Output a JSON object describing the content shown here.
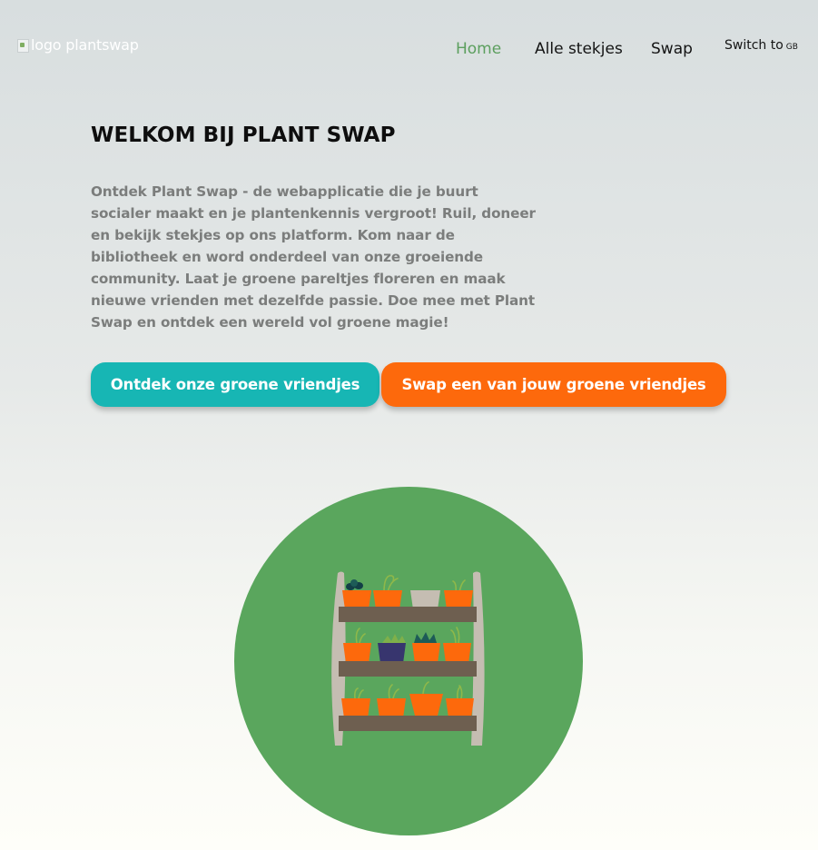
{
  "header": {
    "logo_alt": "logo plantswap",
    "nav": {
      "home": "Home",
      "all_cuttings": "Alle stekjes",
      "swap": "Swap"
    },
    "language_switch": {
      "label": "Switch to",
      "code": "GB"
    }
  },
  "hero": {
    "title": "WELKOM BIJ PLANT SWAP",
    "text": "Ontdek Plant Swap - de webapplicatie die je buurt socialer maakt en je plantenkennis vergroot! Ruil, doneer en bekijk stekjes op ons platform. Kom naar de bibliotheek en word onderdeel van onze groeiende community. Laat je groene pareltjes floreren en maak nieuwe vrienden met dezelfde passie. Doe mee met Plant Swap en ontdek een wereld vol groene magie!",
    "buttons": {
      "discover": "Ontdek onze groene vriendjes",
      "swap": "Swap een van jouw groene vriendjes"
    }
  },
  "colors": {
    "nav_active": "#5c9f5e",
    "teal_button": "#17b6b4",
    "orange_button": "#fd690c",
    "circle_green": "#5aa65d",
    "pot_orange": "#fd690c",
    "pot_navy": "#37356e",
    "pot_beige": "#c5bdb2",
    "shelf_brown": "#6e5f50"
  },
  "illustration": {
    "icon": "plant-shelf-illustration"
  }
}
